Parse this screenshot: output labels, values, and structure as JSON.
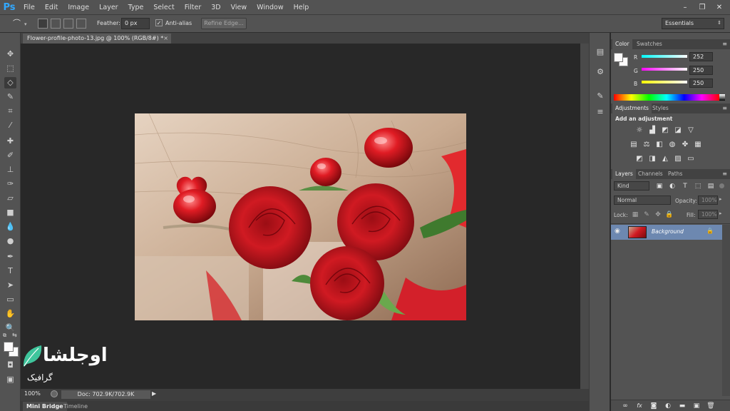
{
  "app": {
    "logo": "Ps"
  },
  "menu": [
    "File",
    "Edit",
    "Image",
    "Layer",
    "Type",
    "Select",
    "Filter",
    "3D",
    "View",
    "Window",
    "Help"
  ],
  "window_controls": {
    "minimize": "–",
    "restore": "❐",
    "close": "✕"
  },
  "options_bar": {
    "feather_label": "Feather:",
    "feather_value": "0 px",
    "antialias_label": "Anti-alias",
    "antialias_checked": true,
    "refine_label": "Refine Edge...",
    "workspace": "Essentials"
  },
  "document": {
    "tab_title": "Flower-profile-photo-13.jpg @ 100% (RGB/8#) *",
    "close": "×",
    "zoom": "100%",
    "doc_info": "Doc: 702.9K/702.9K"
  },
  "bottom_tabs": [
    "Mini Bridge",
    "Timeline"
  ],
  "color_panel": {
    "tabs": [
      "Color",
      "Swatches"
    ],
    "channels": [
      {
        "label": "R",
        "value": "252"
      },
      {
        "label": "G",
        "value": "250"
      },
      {
        "label": "B",
        "value": "250"
      }
    ]
  },
  "adjustments_panel": {
    "tabs": [
      "Adjustments",
      "Styles"
    ],
    "heading": "Add an adjustment"
  },
  "layers_panel": {
    "tabs": [
      "Layers",
      "Channels",
      "Paths"
    ],
    "kind_filter": "Kind",
    "blend_mode": "Normal",
    "opacity_label": "Opacity:",
    "opacity_value": "100%",
    "lock_label": "Lock:",
    "fill_label": "Fill:",
    "fill_value": "100%",
    "layers": [
      {
        "name": "Background",
        "visible": true,
        "locked": true
      }
    ]
  },
  "watermark": {
    "logo_text": "اوجلشا",
    "tagline": "گرافیک"
  },
  "colors": {
    "accent": "#31a8ff",
    "selected_layer": "#6d88b0",
    "watermark": "#3fc59c"
  }
}
